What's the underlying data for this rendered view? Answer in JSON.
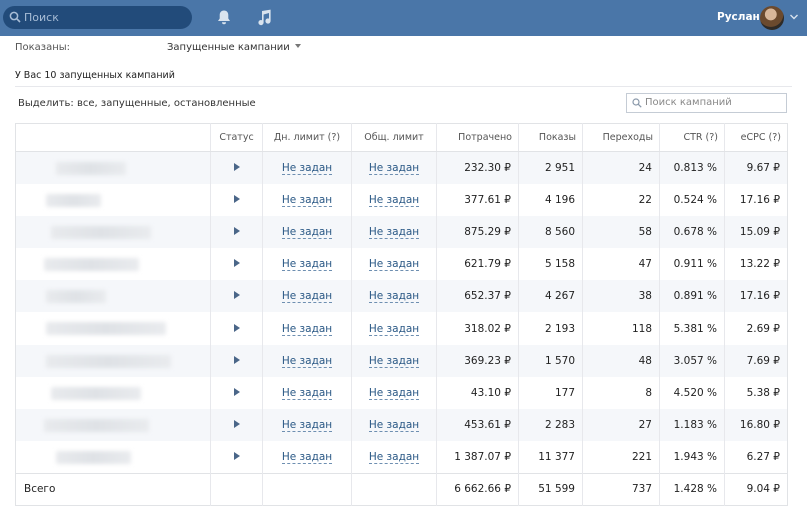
{
  "topbar": {
    "search_placeholder": "Поиск",
    "user_name": "Руслан",
    "bg": "#4a76a8"
  },
  "filters": {
    "shown_label": "Показаны:",
    "shown_value": "Запущенные кампании",
    "count_text": "У Вас 10 запущенных кампаний",
    "select_prefix": "Выделить:",
    "select_all": "все,",
    "select_running": "запущенные,",
    "select_stopped": "остановленные",
    "campaign_search_placeholder": "Поиск кампаний"
  },
  "table": {
    "headers": {
      "status": "Статус",
      "day_limit": "Дн. лимит (?)",
      "total_limit": "Общ. лимит",
      "spent": "Потрачено",
      "impressions": "Показы",
      "clicks": "Переходы",
      "ctr": "CTR (?)",
      "ecpc": "eCPC (?)"
    },
    "rows": [
      {
        "day_limit": "Не задан",
        "total_limit": "Не задан",
        "spent": "232.30 ₽",
        "impressions": "2 951",
        "clicks": "24",
        "ctr": "0.813 %",
        "ecpc": "9.67 ₽"
      },
      {
        "day_limit": "Не задан",
        "total_limit": "Не задан",
        "spent": "377.61 ₽",
        "impressions": "4 196",
        "clicks": "22",
        "ctr": "0.524 %",
        "ecpc": "17.16 ₽"
      },
      {
        "day_limit": "Не задан",
        "total_limit": "Не задан",
        "spent": "875.29 ₽",
        "impressions": "8 560",
        "clicks": "58",
        "ctr": "0.678 %",
        "ecpc": "15.09 ₽"
      },
      {
        "day_limit": "Не задан",
        "total_limit": "Не задан",
        "spent": "621.79 ₽",
        "impressions": "5 158",
        "clicks": "47",
        "ctr": "0.911 %",
        "ecpc": "13.22 ₽"
      },
      {
        "day_limit": "Не задан",
        "total_limit": "Не задан",
        "spent": "652.37 ₽",
        "impressions": "4 267",
        "clicks": "38",
        "ctr": "0.891 %",
        "ecpc": "17.16 ₽"
      },
      {
        "day_limit": "Не задан",
        "total_limit": "Не задан",
        "spent": "318.02 ₽",
        "impressions": "2 193",
        "clicks": "118",
        "ctr": "5.381 %",
        "ecpc": "2.69 ₽"
      },
      {
        "day_limit": "Не задан",
        "total_limit": "Не задан",
        "spent": "369.23 ₽",
        "impressions": "1 570",
        "clicks": "48",
        "ctr": "3.057 %",
        "ecpc": "7.69 ₽"
      },
      {
        "day_limit": "Не задан",
        "total_limit": "Не задан",
        "spent": "43.10 ₽",
        "impressions": "177",
        "clicks": "8",
        "ctr": "4.520 %",
        "ecpc": "5.38 ₽"
      },
      {
        "day_limit": "Не задан",
        "total_limit": "Не задан",
        "spent": "453.61 ₽",
        "impressions": "2 283",
        "clicks": "27",
        "ctr": "1.183 %",
        "ecpc": "16.80 ₽"
      },
      {
        "day_limit": "Не задан",
        "total_limit": "Не задан",
        "spent": "1 387.07 ₽",
        "impressions": "11 377",
        "clicks": "221",
        "ctr": "1.943 %",
        "ecpc": "6.27 ₽"
      }
    ],
    "total": {
      "label": "Всего",
      "spent": "6 662.66 ₽",
      "impressions": "51 599",
      "clicks": "737",
      "ctr": "1.428 %",
      "ecpc": "9.04 ₽"
    }
  }
}
